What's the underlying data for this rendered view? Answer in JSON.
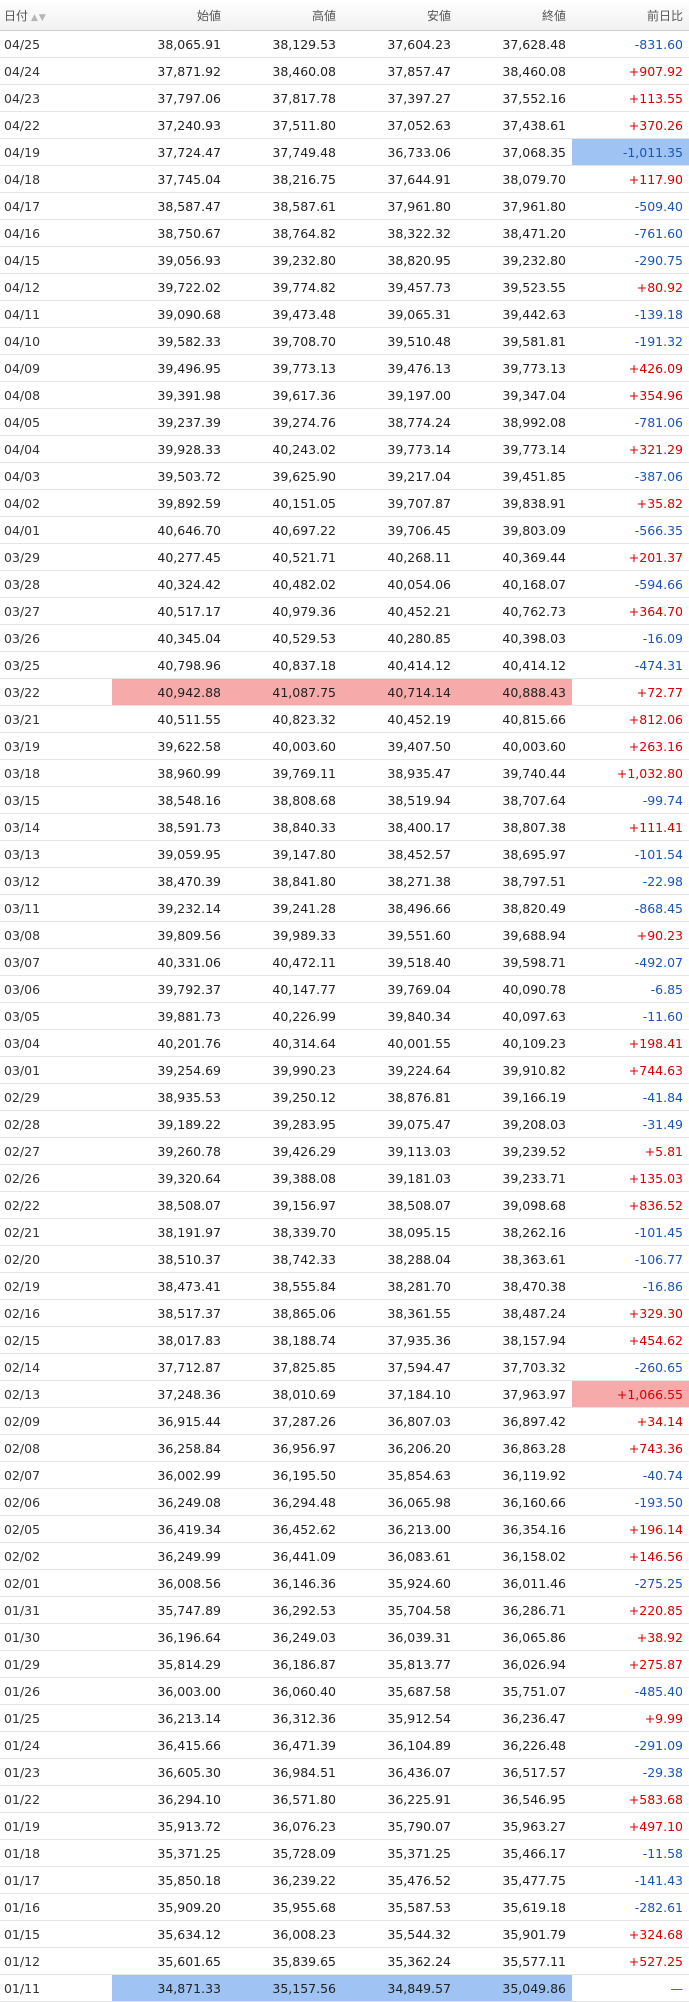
{
  "header": {
    "date": "日付",
    "open": "始値",
    "high": "高値",
    "low": "安値",
    "close": "終値",
    "change": "前日比"
  },
  "colors": {
    "positive": "#d80000",
    "negative": "#1a55b8",
    "highlight_max": "#f6aaaa",
    "highlight_min": "#9fc4f3"
  },
  "rows": [
    {
      "date": "04/25",
      "open": "38,065.91",
      "high": "38,129.53",
      "low": "37,604.23",
      "close": "37,628.48",
      "change": "-831.60"
    },
    {
      "date": "04/24",
      "open": "37,871.92",
      "high": "38,460.08",
      "low": "37,857.47",
      "close": "38,460.08",
      "change": "+907.92"
    },
    {
      "date": "04/23",
      "open": "37,797.06",
      "high": "37,817.78",
      "low": "37,397.27",
      "close": "37,552.16",
      "change": "+113.55"
    },
    {
      "date": "04/22",
      "open": "37,240.93",
      "high": "37,511.80",
      "low": "37,052.63",
      "close": "37,438.61",
      "change": "+370.26"
    },
    {
      "date": "04/19",
      "open": "37,724.47",
      "high": "37,749.48",
      "low": "36,733.06",
      "close": "37,068.35",
      "change": "-1,011.35"
    },
    {
      "date": "04/18",
      "open": "37,745.04",
      "high": "38,216.75",
      "low": "37,644.91",
      "close": "38,079.70",
      "change": "+117.90"
    },
    {
      "date": "04/17",
      "open": "38,587.47",
      "high": "38,587.61",
      "low": "37,961.80",
      "close": "37,961.80",
      "change": "-509.40"
    },
    {
      "date": "04/16",
      "open": "38,750.67",
      "high": "38,764.82",
      "low": "38,322.32",
      "close": "38,471.20",
      "change": "-761.60"
    },
    {
      "date": "04/15",
      "open": "39,056.93",
      "high": "39,232.80",
      "low": "38,820.95",
      "close": "39,232.80",
      "change": "-290.75"
    },
    {
      "date": "04/12",
      "open": "39,722.02",
      "high": "39,774.82",
      "low": "39,457.73",
      "close": "39,523.55",
      "change": "+80.92"
    },
    {
      "date": "04/11",
      "open": "39,090.68",
      "high": "39,473.48",
      "low": "39,065.31",
      "close": "39,442.63",
      "change": "-139.18"
    },
    {
      "date": "04/10",
      "open": "39,582.33",
      "high": "39,708.70",
      "low": "39,510.48",
      "close": "39,581.81",
      "change": "-191.32"
    },
    {
      "date": "04/09",
      "open": "39,496.95",
      "high": "39,773.13",
      "low": "39,476.13",
      "close": "39,773.13",
      "change": "+426.09"
    },
    {
      "date": "04/08",
      "open": "39,391.98",
      "high": "39,617.36",
      "low": "39,197.00",
      "close": "39,347.04",
      "change": "+354.96"
    },
    {
      "date": "04/05",
      "open": "39,237.39",
      "high": "39,274.76",
      "low": "38,774.24",
      "close": "38,992.08",
      "change": "-781.06"
    },
    {
      "date": "04/04",
      "open": "39,928.33",
      "high": "40,243.02",
      "low": "39,773.14",
      "close": "39,773.14",
      "change": "+321.29"
    },
    {
      "date": "04/03",
      "open": "39,503.72",
      "high": "39,625.90",
      "low": "39,217.04",
      "close": "39,451.85",
      "change": "-387.06"
    },
    {
      "date": "04/02",
      "open": "39,892.59",
      "high": "40,151.05",
      "low": "39,707.87",
      "close": "39,838.91",
      "change": "+35.82"
    },
    {
      "date": "04/01",
      "open": "40,646.70",
      "high": "40,697.22",
      "low": "39,706.45",
      "close": "39,803.09",
      "change": "-566.35"
    },
    {
      "date": "03/29",
      "open": "40,277.45",
      "high": "40,521.71",
      "low": "40,268.11",
      "close": "40,369.44",
      "change": "+201.37"
    },
    {
      "date": "03/28",
      "open": "40,324.42",
      "high": "40,482.02",
      "low": "40,054.06",
      "close": "40,168.07",
      "change": "-594.66"
    },
    {
      "date": "03/27",
      "open": "40,517.17",
      "high": "40,979.36",
      "low": "40,452.21",
      "close": "40,762.73",
      "change": "+364.70"
    },
    {
      "date": "03/26",
      "open": "40,345.04",
      "high": "40,529.53",
      "low": "40,280.85",
      "close": "40,398.03",
      "change": "-16.09"
    },
    {
      "date": "03/25",
      "open": "40,798.96",
      "high": "40,837.18",
      "low": "40,414.12",
      "close": "40,414.12",
      "change": "-474.31"
    },
    {
      "date": "03/22",
      "open": "40,942.88",
      "high": "41,087.75",
      "low": "40,714.14",
      "close": "40,888.43",
      "change": "+72.77"
    },
    {
      "date": "03/21",
      "open": "40,511.55",
      "high": "40,823.32",
      "low": "40,452.19",
      "close": "40,815.66",
      "change": "+812.06"
    },
    {
      "date": "03/19",
      "open": "39,622.58",
      "high": "40,003.60",
      "low": "39,407.50",
      "close": "40,003.60",
      "change": "+263.16"
    },
    {
      "date": "03/18",
      "open": "38,960.99",
      "high": "39,769.11",
      "low": "38,935.47",
      "close": "39,740.44",
      "change": "+1,032.80"
    },
    {
      "date": "03/15",
      "open": "38,548.16",
      "high": "38,808.68",
      "low": "38,519.94",
      "close": "38,707.64",
      "change": "-99.74"
    },
    {
      "date": "03/14",
      "open": "38,591.73",
      "high": "38,840.33",
      "low": "38,400.17",
      "close": "38,807.38",
      "change": "+111.41"
    },
    {
      "date": "03/13",
      "open": "39,059.95",
      "high": "39,147.80",
      "low": "38,452.57",
      "close": "38,695.97",
      "change": "-101.54"
    },
    {
      "date": "03/12",
      "open": "38,470.39",
      "high": "38,841.80",
      "low": "38,271.38",
      "close": "38,797.51",
      "change": "-22.98"
    },
    {
      "date": "03/11",
      "open": "39,232.14",
      "high": "39,241.28",
      "low": "38,496.66",
      "close": "38,820.49",
      "change": "-868.45"
    },
    {
      "date": "03/08",
      "open": "39,809.56",
      "high": "39,989.33",
      "low": "39,551.60",
      "close": "39,688.94",
      "change": "+90.23"
    },
    {
      "date": "03/07",
      "open": "40,331.06",
      "high": "40,472.11",
      "low": "39,518.40",
      "close": "39,598.71",
      "change": "-492.07"
    },
    {
      "date": "03/06",
      "open": "39,792.37",
      "high": "40,147.77",
      "low": "39,769.04",
      "close": "40,090.78",
      "change": "-6.85"
    },
    {
      "date": "03/05",
      "open": "39,881.73",
      "high": "40,226.99",
      "low": "39,840.34",
      "close": "40,097.63",
      "change": "-11.60"
    },
    {
      "date": "03/04",
      "open": "40,201.76",
      "high": "40,314.64",
      "low": "40,001.55",
      "close": "40,109.23",
      "change": "+198.41"
    },
    {
      "date": "03/01",
      "open": "39,254.69",
      "high": "39,990.23",
      "low": "39,224.64",
      "close": "39,910.82",
      "change": "+744.63"
    },
    {
      "date": "02/29",
      "open": "38,935.53",
      "high": "39,250.12",
      "low": "38,876.81",
      "close": "39,166.19",
      "change": "-41.84"
    },
    {
      "date": "02/28",
      "open": "39,189.22",
      "high": "39,283.95",
      "low": "39,075.47",
      "close": "39,208.03",
      "change": "-31.49"
    },
    {
      "date": "02/27",
      "open": "39,260.78",
      "high": "39,426.29",
      "low": "39,113.03",
      "close": "39,239.52",
      "change": "+5.81"
    },
    {
      "date": "02/26",
      "open": "39,320.64",
      "high": "39,388.08",
      "low": "39,181.03",
      "close": "39,233.71",
      "change": "+135.03"
    },
    {
      "date": "02/22",
      "open": "38,508.07",
      "high": "39,156.97",
      "low": "38,508.07",
      "close": "39,098.68",
      "change": "+836.52"
    },
    {
      "date": "02/21",
      "open": "38,191.97",
      "high": "38,339.70",
      "low": "38,095.15",
      "close": "38,262.16",
      "change": "-101.45"
    },
    {
      "date": "02/20",
      "open": "38,510.37",
      "high": "38,742.33",
      "low": "38,288.04",
      "close": "38,363.61",
      "change": "-106.77"
    },
    {
      "date": "02/19",
      "open": "38,473.41",
      "high": "38,555.84",
      "low": "38,281.70",
      "close": "38,470.38",
      "change": "-16.86"
    },
    {
      "date": "02/16",
      "open": "38,517.37",
      "high": "38,865.06",
      "low": "38,361.55",
      "close": "38,487.24",
      "change": "+329.30"
    },
    {
      "date": "02/15",
      "open": "38,017.83",
      "high": "38,188.74",
      "low": "37,935.36",
      "close": "38,157.94",
      "change": "+454.62"
    },
    {
      "date": "02/14",
      "open": "37,712.87",
      "high": "37,825.85",
      "low": "37,594.47",
      "close": "37,703.32",
      "change": "-260.65"
    },
    {
      "date": "02/13",
      "open": "37,248.36",
      "high": "38,010.69",
      "low": "37,184.10",
      "close": "37,963.97",
      "change": "+1,066.55"
    },
    {
      "date": "02/09",
      "open": "36,915.44",
      "high": "37,287.26",
      "low": "36,807.03",
      "close": "36,897.42",
      "change": "+34.14"
    },
    {
      "date": "02/08",
      "open": "36,258.84",
      "high": "36,956.97",
      "low": "36,206.20",
      "close": "36,863.28",
      "change": "+743.36"
    },
    {
      "date": "02/07",
      "open": "36,002.99",
      "high": "36,195.50",
      "low": "35,854.63",
      "close": "36,119.92",
      "change": "-40.74"
    },
    {
      "date": "02/06",
      "open": "36,249.08",
      "high": "36,294.48",
      "low": "36,065.98",
      "close": "36,160.66",
      "change": "-193.50"
    },
    {
      "date": "02/05",
      "open": "36,419.34",
      "high": "36,452.62",
      "low": "36,213.00",
      "close": "36,354.16",
      "change": "+196.14"
    },
    {
      "date": "02/02",
      "open": "36,249.99",
      "high": "36,441.09",
      "low": "36,083.61",
      "close": "36,158.02",
      "change": "+146.56"
    },
    {
      "date": "02/01",
      "open": "36,008.56",
      "high": "36,146.36",
      "low": "35,924.60",
      "close": "36,011.46",
      "change": "-275.25"
    },
    {
      "date": "01/31",
      "open": "35,747.89",
      "high": "36,292.53",
      "low": "35,704.58",
      "close": "36,286.71",
      "change": "+220.85"
    },
    {
      "date": "01/30",
      "open": "36,196.64",
      "high": "36,249.03",
      "low": "36,039.31",
      "close": "36,065.86",
      "change": "+38.92"
    },
    {
      "date": "01/29",
      "open": "35,814.29",
      "high": "36,186.87",
      "low": "35,813.77",
      "close": "36,026.94",
      "change": "+275.87"
    },
    {
      "date": "01/26",
      "open": "36,003.00",
      "high": "36,060.40",
      "low": "35,687.58",
      "close": "35,751.07",
      "change": "-485.40"
    },
    {
      "date": "01/25",
      "open": "36,213.14",
      "high": "36,312.36",
      "low": "35,912.54",
      "close": "36,236.47",
      "change": "+9.99"
    },
    {
      "date": "01/24",
      "open": "36,415.66",
      "high": "36,471.39",
      "low": "36,104.89",
      "close": "36,226.48",
      "change": "-291.09"
    },
    {
      "date": "01/23",
      "open": "36,605.30",
      "high": "36,984.51",
      "low": "36,436.07",
      "close": "36,517.57",
      "change": "-29.38"
    },
    {
      "date": "01/22",
      "open": "36,294.10",
      "high": "36,571.80",
      "low": "36,225.91",
      "close": "36,546.95",
      "change": "+583.68"
    },
    {
      "date": "01/19",
      "open": "35,913.72",
      "high": "36,076.23",
      "low": "35,790.07",
      "close": "35,963.27",
      "change": "+497.10"
    },
    {
      "date": "01/18",
      "open": "35,371.25",
      "high": "35,728.09",
      "low": "35,371.25",
      "close": "35,466.17",
      "change": "-11.58"
    },
    {
      "date": "01/17",
      "open": "35,850.18",
      "high": "36,239.22",
      "low": "35,476.52",
      "close": "35,477.75",
      "change": "-141.43"
    },
    {
      "date": "01/16",
      "open": "35,909.20",
      "high": "35,955.68",
      "low": "35,587.53",
      "close": "35,619.18",
      "change": "-282.61"
    },
    {
      "date": "01/15",
      "open": "35,634.12",
      "high": "36,008.23",
      "low": "35,544.32",
      "close": "35,901.79",
      "change": "+324.68"
    },
    {
      "date": "01/12",
      "open": "35,601.65",
      "high": "35,839.65",
      "low": "35,362.24",
      "close": "35,577.11",
      "change": "+527.25"
    },
    {
      "date": "01/11",
      "open": "34,871.33",
      "high": "35,157.56",
      "low": "34,849.57",
      "close": "35,049.86",
      "change": "—"
    }
  ],
  "highlights": {
    "max_ohlc_row": "03/22",
    "min_ohlc_row": "01/11",
    "max_change_row": "02/13",
    "min_change_row": "04/19"
  }
}
